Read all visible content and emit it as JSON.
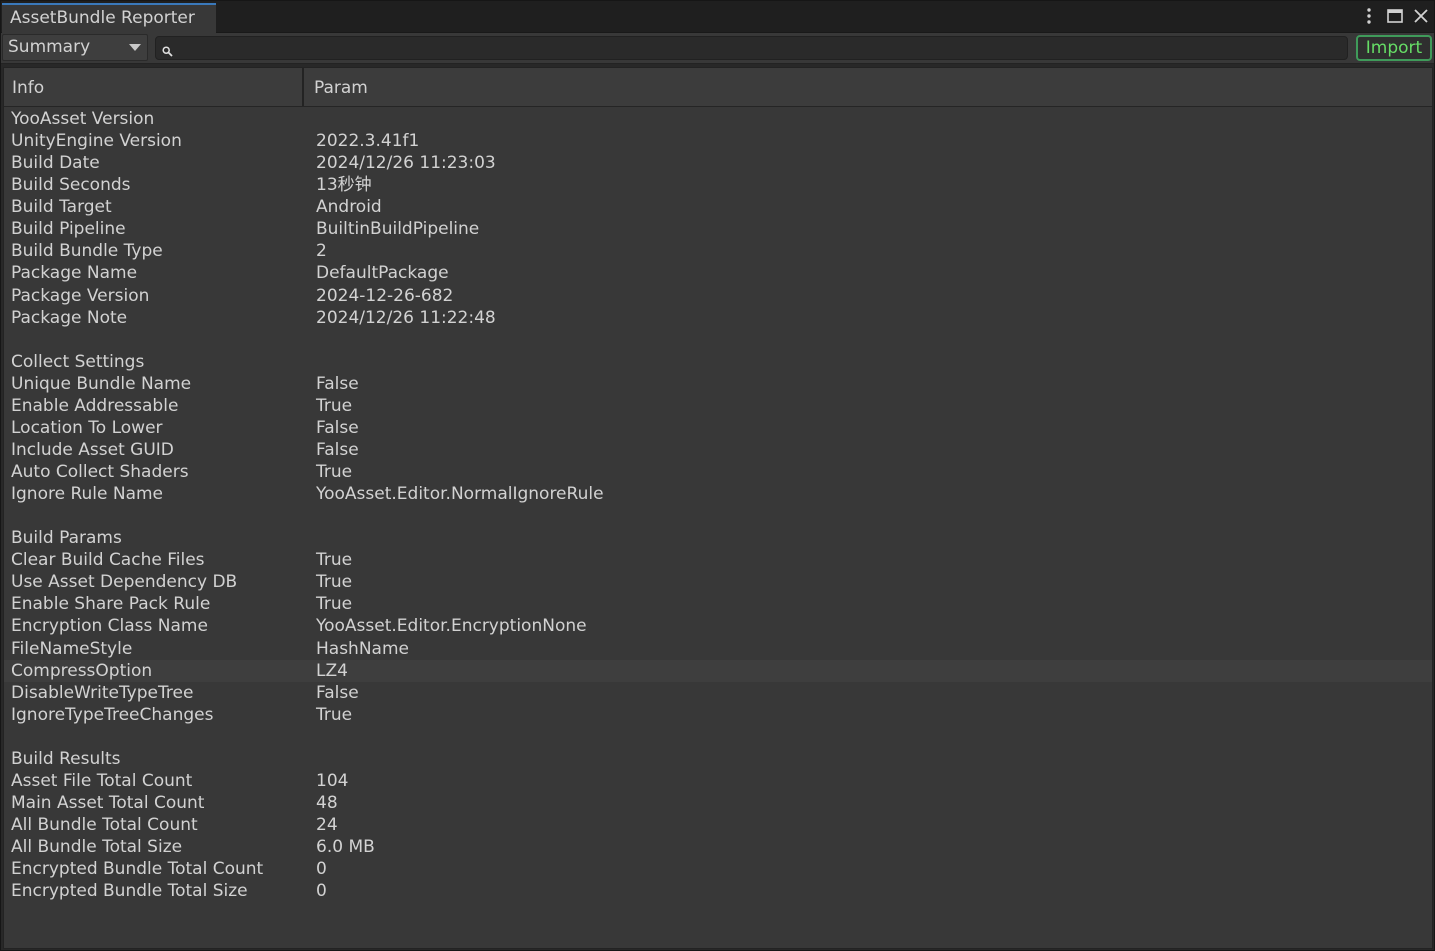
{
  "window": {
    "tab_title": "AssetBundle Reporter"
  },
  "toolbar": {
    "view_mode": "Summary",
    "search_value": "",
    "import_label": "Import"
  },
  "table": {
    "columns": [
      "Info",
      "Param"
    ],
    "rows": [
      {
        "info": "YooAsset Version",
        "param": ""
      },
      {
        "info": "UnityEngine Version",
        "param": "2022.3.41f1"
      },
      {
        "info": "Build Date",
        "param": "2024/12/26 11:23:03"
      },
      {
        "info": "Build Seconds",
        "param": "13秒钟"
      },
      {
        "info": "Build Target",
        "param": "Android"
      },
      {
        "info": "Build Pipeline",
        "param": "BuiltinBuildPipeline"
      },
      {
        "info": "Build Bundle Type",
        "param": "2"
      },
      {
        "info": "Package Name",
        "param": "DefaultPackage"
      },
      {
        "info": "Package Version",
        "param": "2024-12-26-682"
      },
      {
        "info": "Package Note",
        "param": "2024/12/26 11:22:48"
      },
      {
        "info": "",
        "param": ""
      },
      {
        "info": "Collect Settings",
        "param": ""
      },
      {
        "info": "Unique Bundle Name",
        "param": "False"
      },
      {
        "info": "Enable Addressable",
        "param": "True"
      },
      {
        "info": "Location To Lower",
        "param": "False"
      },
      {
        "info": "Include Asset GUID",
        "param": "False"
      },
      {
        "info": "Auto Collect Shaders",
        "param": "True"
      },
      {
        "info": "Ignore Rule Name",
        "param": "YooAsset.Editor.NormalIgnoreRule"
      },
      {
        "info": "",
        "param": ""
      },
      {
        "info": "Build Params",
        "param": ""
      },
      {
        "info": "Clear Build Cache Files",
        "param": "True"
      },
      {
        "info": "Use Asset Dependency DB",
        "param": "True"
      },
      {
        "info": "Enable Share Pack Rule",
        "param": "True"
      },
      {
        "info": "Encryption Class Name",
        "param": "YooAsset.Editor.EncryptionNone"
      },
      {
        "info": "FileNameStyle",
        "param": "HashName"
      },
      {
        "info": "CompressOption",
        "param": "LZ4",
        "highlighted": true
      },
      {
        "info": "DisableWriteTypeTree",
        "param": "False"
      },
      {
        "info": "IgnoreTypeTreeChanges",
        "param": "True"
      },
      {
        "info": "",
        "param": ""
      },
      {
        "info": "Build Results",
        "param": ""
      },
      {
        "info": "Asset File Total Count",
        "param": "104"
      },
      {
        "info": "Main Asset Total Count",
        "param": "48"
      },
      {
        "info": "All Bundle Total Count",
        "param": "24"
      },
      {
        "info": "All Bundle Total Size",
        "param": "6.0 MB"
      },
      {
        "info": "Encrypted Bundle Total Count",
        "param": "0"
      },
      {
        "info": "Encrypted Bundle Total Size",
        "param": "0"
      }
    ]
  },
  "icons": {
    "menu": "kebab-menu-icon",
    "maximize": "maximize-icon",
    "close": "close-icon",
    "search": "search-icon",
    "dropdown": "chevron-down-icon"
  },
  "colors": {
    "tab_accent": "#3a79bb",
    "import_border": "#3f9b5a",
    "import_text": "#66dd66"
  }
}
